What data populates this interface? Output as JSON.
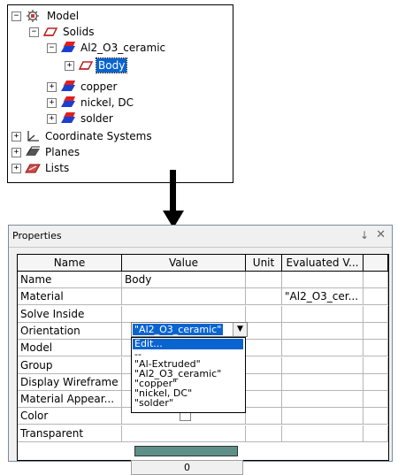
{
  "tree": {
    "model": "Model",
    "solids": "Solids",
    "al2o3": "Al2_O3_ceramic",
    "body": "Body",
    "copper": "copper",
    "nickel": "nickel, DC",
    "solder": "solder",
    "coord": "Coordinate Systems",
    "planes": "Planes",
    "lists": "Lists"
  },
  "panel": {
    "title": "Properties",
    "pin_glyph": "↓",
    "close_glyph": "✕"
  },
  "grid": {
    "headers": [
      "Name",
      "Value",
      "Unit",
      "Evaluated V..."
    ],
    "rows": [
      {
        "name": "Name",
        "value": "Body",
        "evaluated": ""
      },
      {
        "name": "Material",
        "value": "",
        "evaluated": "\"Al2_O3_cer..."
      },
      {
        "name": "Solve Inside",
        "value": "",
        "evaluated": ""
      },
      {
        "name": "Orientation",
        "value": "",
        "evaluated": ""
      },
      {
        "name": "Model",
        "value": "",
        "evaluated": ""
      },
      {
        "name": "Group",
        "value": "",
        "evaluated": ""
      },
      {
        "name": "Display Wireframe",
        "value": "",
        "evaluated": ""
      },
      {
        "name": "Material Appear...",
        "value": "",
        "evaluated": ""
      },
      {
        "name": "Color",
        "value": "",
        "evaluated": ""
      },
      {
        "name": "Transparent",
        "value": "0",
        "evaluated": ""
      }
    ],
    "material_combo_value": "\"Al2_O3_ceramic\"",
    "color_swatch": "#5e8f89",
    "dropdown_options": [
      "Edit...",
      "--",
      "\"Al-Extruded\"",
      "\"Al2_O3_ceramic\"",
      "\"copper\"",
      "\"nickel, DC\"",
      "\"solder\""
    ]
  },
  "colors": {
    "selection": "#0a64d0",
    "solid_red": "#e02020",
    "solid_blue": "#1a3fd0"
  }
}
